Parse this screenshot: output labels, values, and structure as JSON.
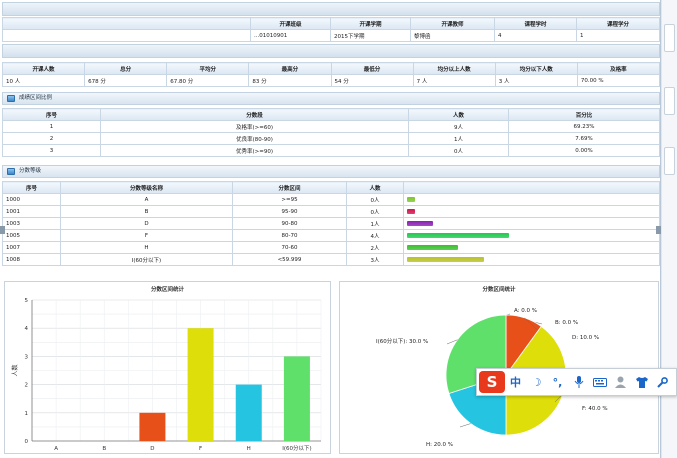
{
  "course_info": {
    "headers": [
      "开课班级",
      "开课学期",
      "开课教师",
      "课程学时",
      "课程学分"
    ],
    "row": [
      "...01010901",
      "2015下学期",
      "黎博函",
      "4",
      "1"
    ]
  },
  "score_summary": {
    "headers": [
      "开课人数",
      "总分",
      "平均分",
      "最高分",
      "最低分",
      "均分以上人数",
      "均分以下人数",
      "及格率"
    ],
    "row": [
      "10 人",
      "678 分",
      "67.80 分",
      "83 分",
      "54 分",
      "7 人",
      "3 人",
      "70.00 %"
    ]
  },
  "ratio_section": {
    "title": "成绩区间比例",
    "headers": [
      "序号",
      "分数段",
      "人数",
      "百分比"
    ],
    "rows": [
      [
        "1",
        "及格率(>=60)",
        "9人",
        "69.23%"
      ],
      [
        "2",
        "优良率(80-90)",
        "1人",
        "7.69%"
      ],
      [
        "3",
        "优秀率(>=90)",
        "0人",
        "0.00%"
      ]
    ]
  },
  "grade_section": {
    "title": "分数等级",
    "headers": [
      "序号",
      "分数等级名称",
      "分数区间",
      "人数",
      ""
    ],
    "rows": [
      {
        "id": "1000",
        "name": "A",
        "range": ">=95",
        "count": "0人",
        "n": 0,
        "color": "#7dc62e"
      },
      {
        "id": "1001",
        "name": "B",
        "range": "95-90",
        "count": "0人",
        "n": 0,
        "color": "#d2144f"
      },
      {
        "id": "1003",
        "name": "D",
        "range": "90-80",
        "count": "1人",
        "n": 1,
        "color": "#8a1fb2"
      },
      {
        "id": "1005",
        "name": "F",
        "range": "80-70",
        "count": "4人",
        "n": 4,
        "color": "#1fc94f"
      },
      {
        "id": "1007",
        "name": "H",
        "range": "70-60",
        "count": "2人",
        "n": 2,
        "color": "#39c02e"
      },
      {
        "id": "1008",
        "name": "I(60分以下)",
        "range": "<59.999",
        "count": "3人",
        "n": 3,
        "color": "#b8c226"
      }
    ]
  },
  "chart_data": [
    {
      "type": "bar",
      "title": "分数区间统计",
      "xlabel": "",
      "ylabel": "人数",
      "categories": [
        "A",
        "B",
        "D",
        "F",
        "H",
        "I(60分以下)"
      ],
      "values": [
        0,
        0,
        1,
        4,
        2,
        3
      ],
      "colors": [
        "#7dc62e",
        "#d2144f",
        "#e8501a",
        "#dede0a",
        "#25c4e0",
        "#5ee06a"
      ],
      "ylim": [
        0,
        5
      ],
      "yticks": [
        "0",
        "1",
        "2",
        "3",
        "4",
        "5"
      ]
    },
    {
      "type": "pie",
      "title": "分数区间统计",
      "labels": [
        "A: 0.0 %",
        "B: 0.0 %",
        "D: 10.0 %",
        "F: 40.0 %",
        "H: 20.0 %",
        "I(60分以下): 30.0 %"
      ],
      "values": [
        0,
        0,
        10,
        40,
        20,
        30
      ],
      "colors": [
        "#7dc62e",
        "#d2144f",
        "#e8501a",
        "#dede0a",
        "#25c4e0",
        "#5ee06a"
      ]
    }
  ],
  "ime": {
    "logo": "S",
    "lang": "中",
    "moon": "☽",
    "punct": "°,"
  }
}
